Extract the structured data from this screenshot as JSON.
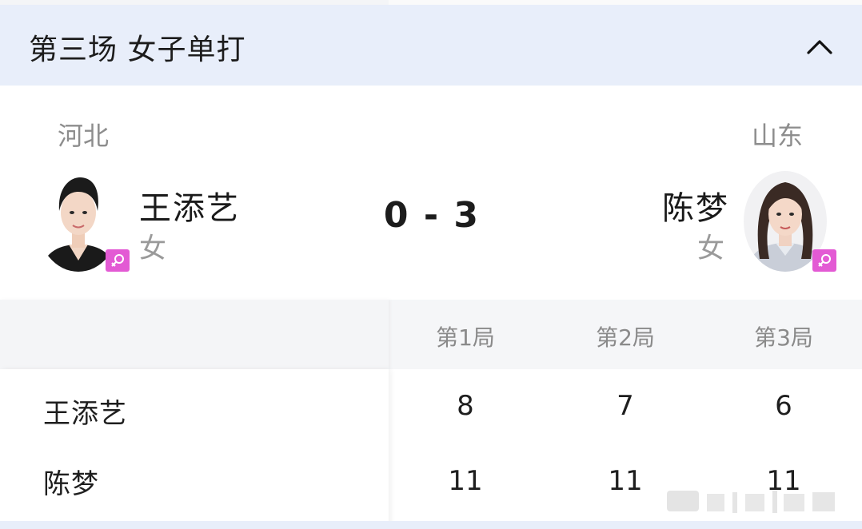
{
  "header": {
    "title": "第三场 女子单打",
    "collapse_icon": "chevron-up-icon"
  },
  "match": {
    "score": "0 - 3",
    "left_player": {
      "team": "河北",
      "name": "王添艺",
      "gender": "女",
      "gender_icon": "female-icon"
    },
    "right_player": {
      "team": "山东",
      "name": "陈梦",
      "gender": "女",
      "gender_icon": "female-icon"
    }
  },
  "scoreboard": {
    "columns": [
      "第1局",
      "第2局",
      "第3局"
    ],
    "rows": [
      {
        "name": "王添艺",
        "scores": [
          "8",
          "7",
          "6"
        ]
      },
      {
        "name": "陈梦",
        "scores": [
          "11",
          "11",
          "11"
        ]
      }
    ]
  },
  "colors": {
    "header_bg": "#e8eefa",
    "badge": "#e35ad4",
    "muted_text": "#8d8d8d"
  }
}
